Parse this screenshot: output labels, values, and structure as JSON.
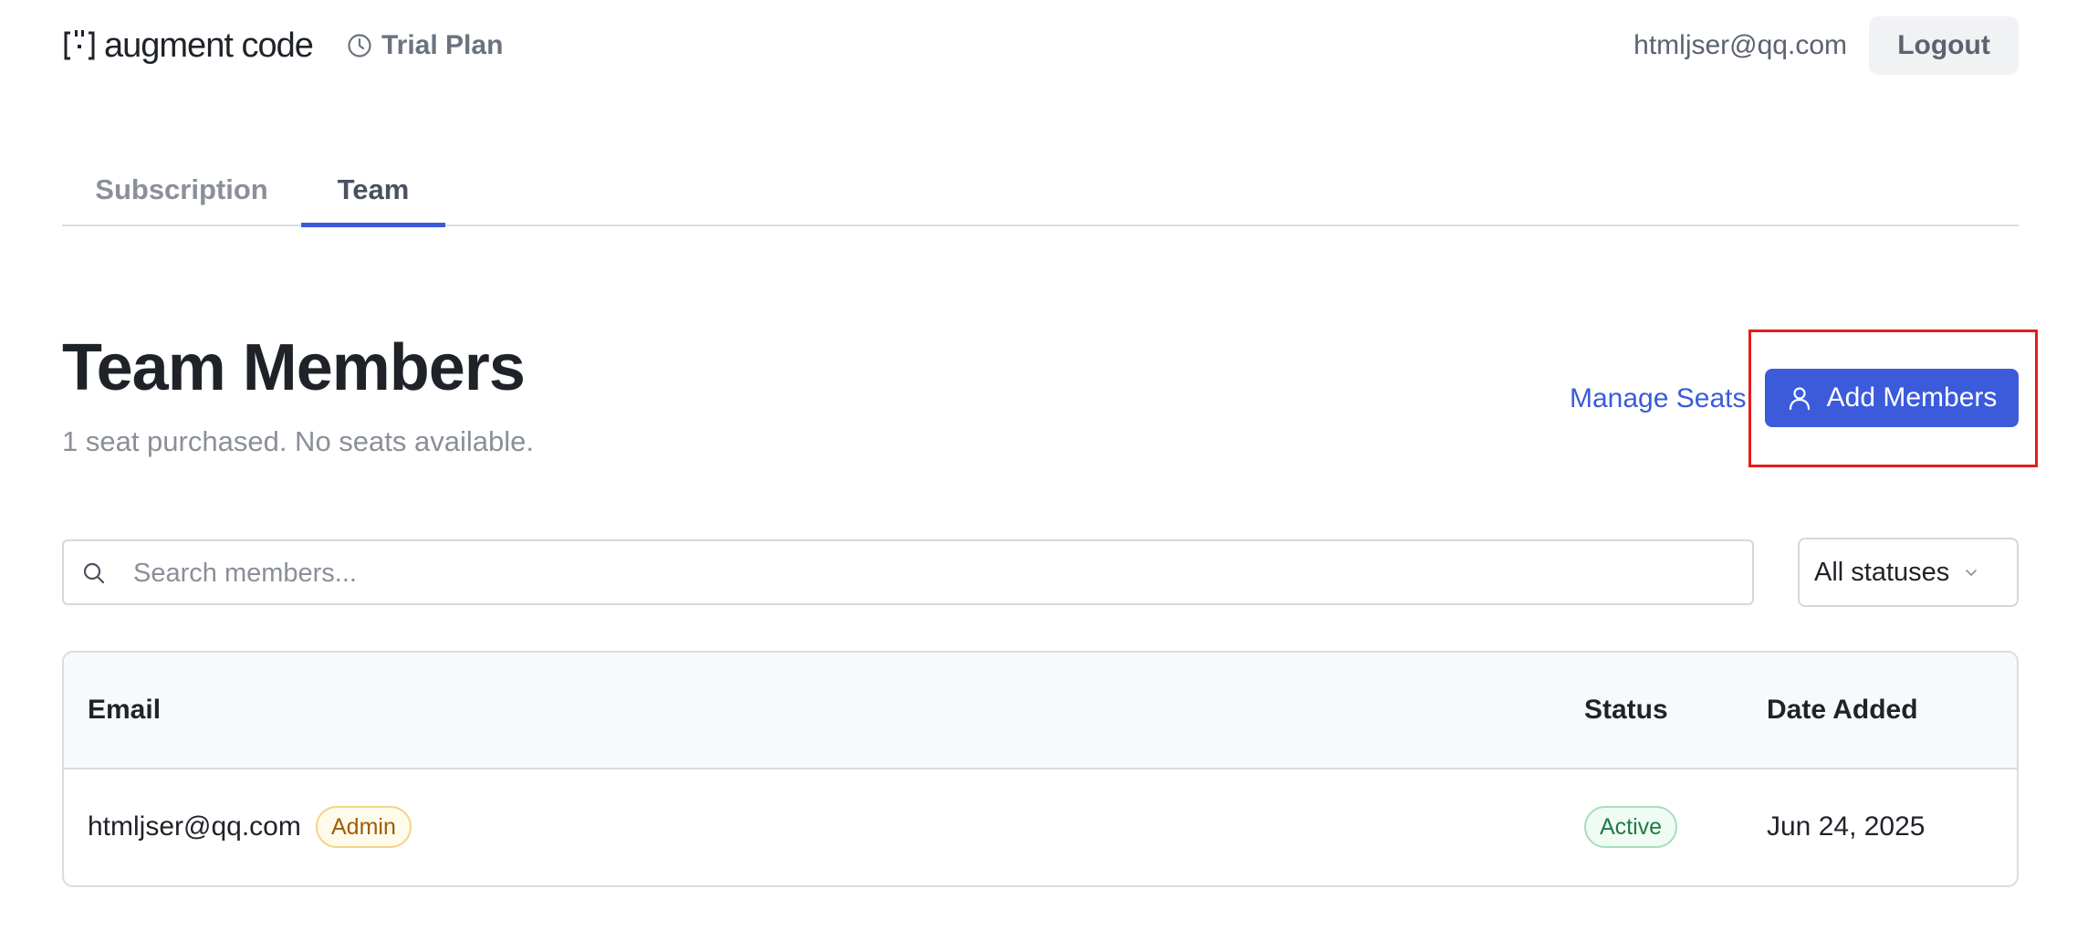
{
  "header": {
    "logo_text": "augment code",
    "logo_icon": "brackets-logo-icon",
    "plan_icon": "clock-icon",
    "plan_label": "Trial Plan",
    "user_email": "htmljser@qq.com",
    "logout_label": "Logout"
  },
  "tabs": [
    {
      "label": "Subscription",
      "active": false
    },
    {
      "label": "Team",
      "active": true
    }
  ],
  "team": {
    "title": "Team Members",
    "subtitle": "1 seat purchased. No seats available.",
    "manage_seats_label": "Manage Seats",
    "add_members_label": "Add Members",
    "add_members_icon": "person-icon"
  },
  "search": {
    "placeholder": "Search members...",
    "value": "",
    "icon": "search-icon"
  },
  "status_filter": {
    "selected": "All statuses",
    "icon": "chevron-down-icon"
  },
  "table": {
    "columns": [
      "Email",
      "Status",
      "Date Added"
    ],
    "rows": [
      {
        "email": "htmljser@qq.com",
        "role_badge": "Admin",
        "status": "Active",
        "date_added": "Jun 24, 2025"
      }
    ]
  },
  "colors": {
    "accent": "#3b5bdb",
    "highlight": "#e51c1c",
    "admin_badge": "#a15c07",
    "active_badge": "#1f7a45"
  }
}
